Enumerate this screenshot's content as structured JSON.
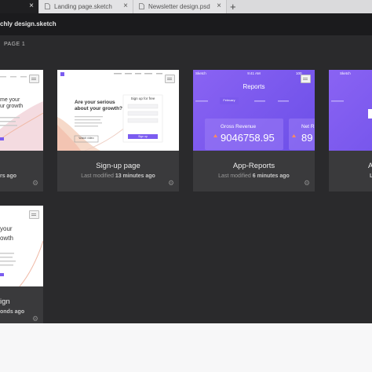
{
  "tabs": [
    {
      "label": "",
      "active": true
    },
    {
      "label": "Landing page.sketch",
      "active": false
    },
    {
      "label": "Newsletter design.psd",
      "active": false
    }
  ],
  "new_tab": "+",
  "close_glyph": "×",
  "document": {
    "title": "chly design.sketch"
  },
  "page_label": "PAGE 1",
  "cards": [
    {
      "name": "e",
      "modified_prefix": "",
      "modified_time": "rs ago",
      "thumb": {
        "heading": "me your\nur growth"
      }
    },
    {
      "name": "Sign-up page",
      "modified_prefix": "Last modified",
      "modified_time": "13 minutes ago",
      "thumb": {
        "heading": "Are your serious\nabout your growth?",
        "form_title": "Sign up for free",
        "form_button": "Sign up",
        "cta": "Watch video"
      }
    },
    {
      "name": "App-Reports",
      "modified_prefix": "Last modified",
      "modified_time": "6 minutes ago",
      "thumb": {
        "carrier": "Sketch",
        "time": "9:41 AM",
        "battery": "100",
        "title": "Reports",
        "month": "February",
        "stat_label": "Gross Revenue",
        "stat_value": "9046758.95",
        "stat_label2": "Net R",
        "stat_value2": "89"
      }
    },
    {
      "name": "A",
      "modified_prefix": "",
      "modified_time": "L",
      "thumb": {
        "carrier": "Sketch"
      }
    },
    {
      "name": "ign",
      "modified_prefix": "",
      "modified_time": "onds ago",
      "thumb": {
        "heading": "your\nowth"
      }
    }
  ],
  "colors": {
    "accent": "#7b5cf0",
    "card_bg": "#3a3a3c",
    "app_bg": "#2a2a2c"
  }
}
